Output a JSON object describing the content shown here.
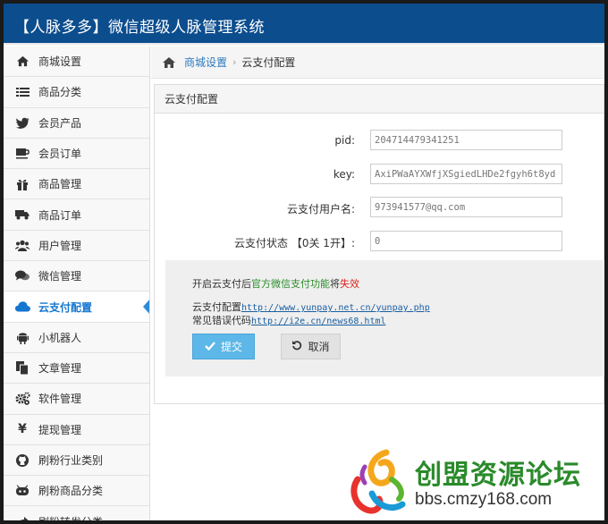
{
  "header": {
    "title": "【人脉多多】微信超级人脉管理系统"
  },
  "sidebar": {
    "items": [
      {
        "label": "商城设置",
        "icon": "home-icon"
      },
      {
        "label": "商品分类",
        "icon": "list-icon"
      },
      {
        "label": "会员产品",
        "icon": "twitter-icon"
      },
      {
        "label": "会员订单",
        "icon": "coffee-icon"
      },
      {
        "label": "商品管理",
        "icon": "gift-icon"
      },
      {
        "label": "商品订单",
        "icon": "truck-icon"
      },
      {
        "label": "用户管理",
        "icon": "users-icon"
      },
      {
        "label": "微信管理",
        "icon": "comments-icon"
      },
      {
        "label": "云支付配置",
        "icon": "cloud-icon",
        "active": true
      },
      {
        "label": "小机器人",
        "icon": "android-icon"
      },
      {
        "label": "文章管理",
        "icon": "copy-icon"
      },
      {
        "label": "软件管理",
        "icon": "cogs-icon"
      },
      {
        "label": "提现管理",
        "icon": "yen-icon"
      },
      {
        "label": "刷粉行业类别",
        "icon": "github-icon"
      },
      {
        "label": "刷粉商品分类",
        "icon": "bug-icon"
      },
      {
        "label": "刷粉转发分类",
        "icon": "share-icon"
      }
    ]
  },
  "breadcrumb": {
    "root": "商城设置",
    "sep": "›",
    "current": "云支付配置"
  },
  "panel": {
    "title": "云支付配置",
    "fields": [
      {
        "label": "pid:",
        "value": "204714479341251"
      },
      {
        "label": "key:",
        "value": "AxiPWaAYXWfjXSgiedLHDe2fgyh6t8yd"
      },
      {
        "label": "云支付用户名:",
        "value": "973941577@qq.com"
      },
      {
        "label": "云支付状态 【0关 1开】:",
        "value": "0"
      }
    ]
  },
  "info": {
    "line1_prefix": "开启云支付后",
    "line1_green": "官方微信支付功能",
    "line1_mid": "将",
    "line1_red": "失效",
    "line2_label": "云支付配置",
    "line2_link": "http://www.yunpay.net.cn/yunpay.php",
    "line3_label": "常见错误代码",
    "line3_link": "http://i2e.cn/news68.html"
  },
  "buttons": {
    "submit": "提交",
    "cancel": "取消"
  },
  "watermark": {
    "text": "创盟资源论坛",
    "url": "bbs.cmzy168.com"
  },
  "colors": {
    "header_bg": "#0c4d8e",
    "active": "#1476d0",
    "submit_bg": "#5db7e8",
    "info_green": "#2a8c2a",
    "info_red": "#d9221c"
  }
}
